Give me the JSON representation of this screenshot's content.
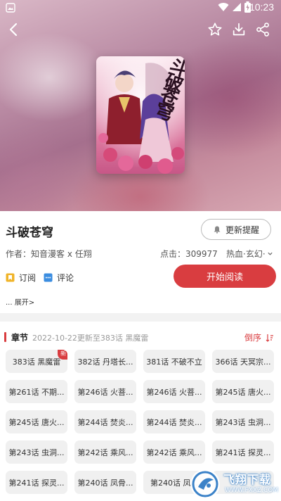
{
  "status": {
    "time": "10:23"
  },
  "book": {
    "title": "斗破苍穹",
    "cover_text": "斗破苍穹",
    "remind_label": "更新提醒",
    "author": "作者：知音漫客 x 任翔",
    "clicks": "点击：309977",
    "genre": "热血·玄幻·",
    "subscribe_label": "订阅",
    "comment_label": "评论",
    "read_label": "开始阅读",
    "expand_label": "... 展开>"
  },
  "chapters": {
    "label": "章节",
    "update_text": "2022-10-22更新至383话 黑魔雷",
    "sort_label": "倒序",
    "items": [
      "383话 黑魔雷",
      "382话 丹塔长...",
      "381话 不破不立",
      "366话 天冥宗...",
      "第261话 不期...",
      "第246话 火菩...",
      "第246话 火菩...",
      "第245话 唐火...",
      "第245话 唐火...",
      "第244话 焚炎...",
      "第244话 焚炎...",
      "第243话 虫洞...",
      "第243话 虫洞...",
      "第242话 乘风...",
      "第242话 乘风...",
      "第241话 探灵...",
      "第241话 探灵...",
      "第240话 凤骨...",
      "第240话 凤...",
      ""
    ],
    "new_badge": "新"
  },
  "watermark": {
    "text": "飞翔下载",
    "url": "WWW.FXXZ.COM"
  },
  "colors": {
    "accent": "#d93d40",
    "chip_bg": "#f0f0f0"
  }
}
